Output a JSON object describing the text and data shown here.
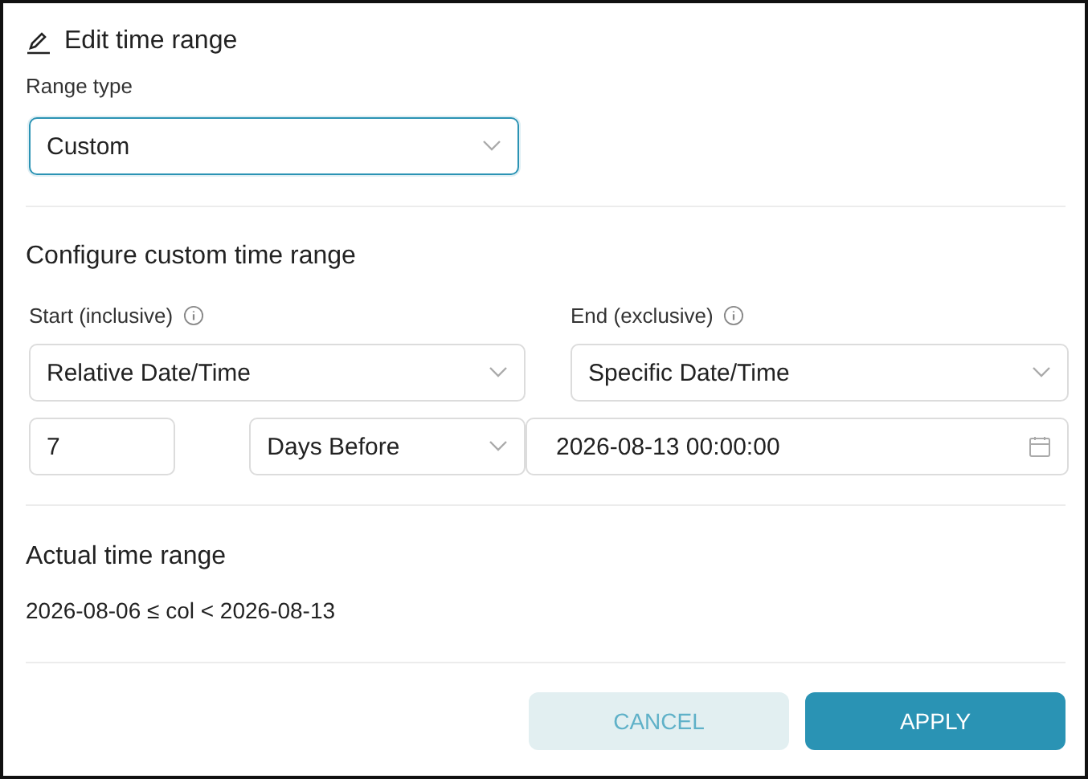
{
  "dialog": {
    "title": "Edit time range"
  },
  "range_type": {
    "label": "Range type",
    "value": "Custom",
    "focused": true
  },
  "section_title": "Configure custom time range",
  "start": {
    "label": "Start (inclusive)",
    "type_value": "Relative Date/Time",
    "amount": "7",
    "unit": "Days Before"
  },
  "end": {
    "label": "End (exclusive)",
    "type_value": "Specific Date/Time",
    "datetime": "2026-08-13 00:00:00"
  },
  "actual": {
    "title": "Actual time range",
    "text": "2026-08-06 ≤ col < 2026-08-13"
  },
  "buttons": [
    {
      "label": "CANCEL",
      "kind": "secondary"
    },
    {
      "label": "APPLY",
      "kind": "primary"
    }
  ]
}
